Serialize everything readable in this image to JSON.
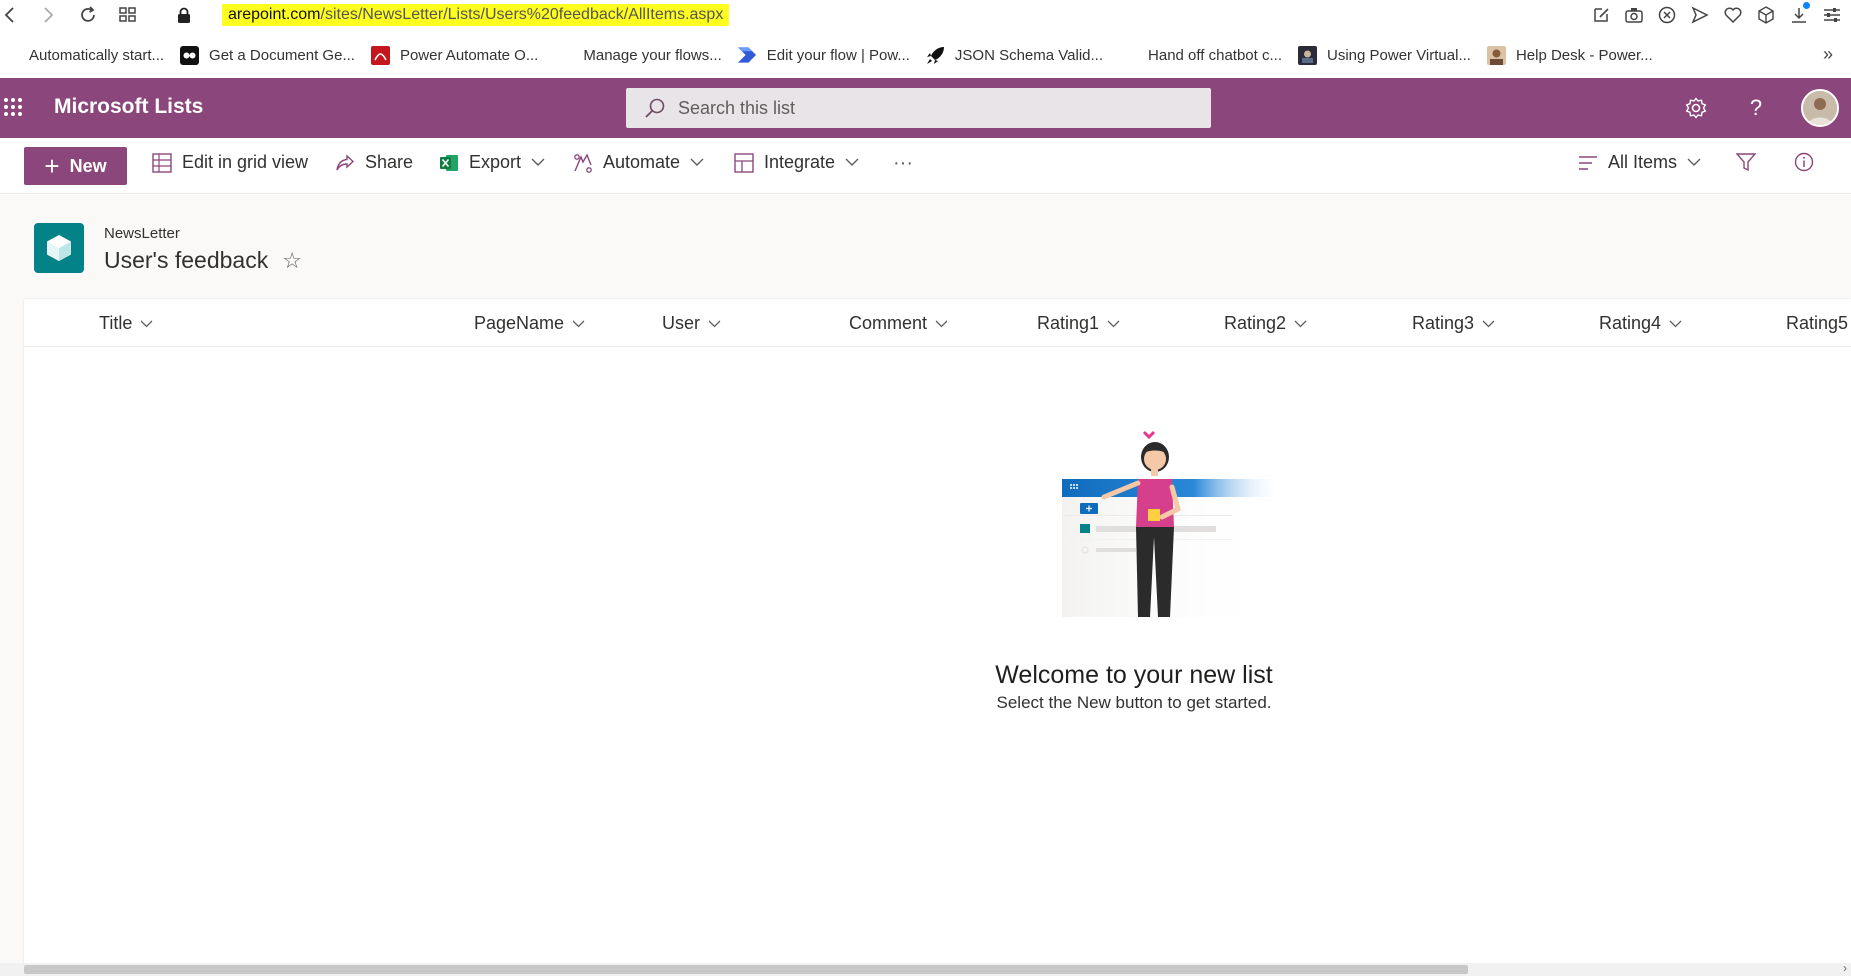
{
  "browser": {
    "url_domain": "arepoint.com",
    "url_path": "/sites/NewsLetter/Lists/Users%20feedback/AllItems.aspx",
    "bookmarks": [
      {
        "label": "Automatically start...",
        "icon": "microsoft-logo-icon"
      },
      {
        "label": "Get a Document Ge...",
        "icon": "dot-logo-icon"
      },
      {
        "label": "Power Automate O...",
        "icon": "pdf-icon"
      },
      {
        "label": "Manage your flows...",
        "icon": "microsoft-logo-icon"
      },
      {
        "label": "Edit your flow | Pow...",
        "icon": "power-automate-icon"
      },
      {
        "label": "JSON Schema Valid...",
        "icon": "rocket-icon"
      },
      {
        "label": "Hand off chatbot c...",
        "icon": "microsoft-logo-icon"
      },
      {
        "label": "Using Power Virtual...",
        "icon": "video-thumb-icon"
      },
      {
        "label": "Help Desk - Power...",
        "icon": "person-thumb-icon"
      }
    ],
    "more": "»"
  },
  "suite": {
    "app_name": "Microsoft Lists",
    "search_placeholder": "Search this list",
    "help": "?"
  },
  "commands": {
    "new": "New",
    "edit_grid": "Edit in grid view",
    "share": "Share",
    "export": "Export",
    "automate": "Automate",
    "integrate": "Integrate",
    "more": "···",
    "view": "All Items"
  },
  "list": {
    "site_name": "NewsLetter",
    "title": "User's feedback",
    "star": "☆",
    "columns": [
      "Title",
      "PageName",
      "User",
      "Comment",
      "Rating1",
      "Rating2",
      "Rating3",
      "Rating4",
      "Rating5"
    ]
  },
  "empty_state": {
    "heading": "Welcome to your new list",
    "subtext": "Select the New button to get started."
  },
  "colors": {
    "brand": "#8b467c",
    "site_logo": "#038387"
  }
}
